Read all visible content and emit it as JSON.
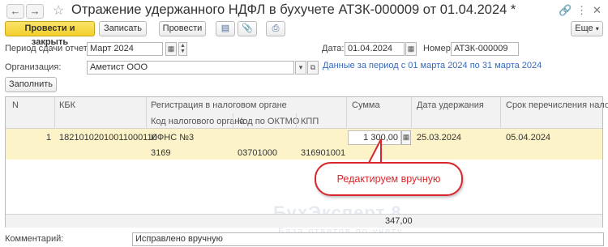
{
  "window": {
    "title": "Отражение удержанного НДФЛ в бухучете АТЗК-000009 от 01.04.2024 *"
  },
  "toolbar": {
    "post_close_label": "Провести и закрыть",
    "save_label": "Записать",
    "post_label": "Провести",
    "more_label": "Еще"
  },
  "form": {
    "period_label": "Период сдачи отчетов:",
    "period_value": "Март 2024",
    "date_label": "Дата:",
    "date_value": "01.04.2024",
    "number_label": "Номер:",
    "number_value": "АТЗК-000009",
    "org_label": "Организация:",
    "org_value": "Аметист ООО",
    "period_link": "Данные за период с 01 марта 2024 по 31 марта 2024",
    "fill_label": "Заполнить"
  },
  "table": {
    "headers": {
      "n": "N",
      "kbk": "КБК",
      "registration": "Регистрация в налоговом органе",
      "tax_code": "Код налогового органа",
      "oktmo": "Код по ОКТМО",
      "kpp": "КПП",
      "sum": "Сумма",
      "withhold_date": "Дата удержания",
      "transfer_deadline": "Срок перечисления налога"
    },
    "rows": [
      {
        "n": "1",
        "kbk": "18210102010011000110",
        "tax_office": "ИФНС №3",
        "tax_code": "3169",
        "oktmo": "03701000",
        "kpp": "316901001",
        "sum": "1 300,00",
        "withhold_date": "25.03.2024",
        "transfer_deadline": "05.04.2024"
      }
    ],
    "total": "347,00"
  },
  "comment": {
    "label": "Комментарий:",
    "value": "Исправлено вручную"
  },
  "watermark": {
    "text": "БухЭксперт 8",
    "sub": "База ответов по учету"
  },
  "callout": {
    "text": "Редактируем вручную"
  }
}
